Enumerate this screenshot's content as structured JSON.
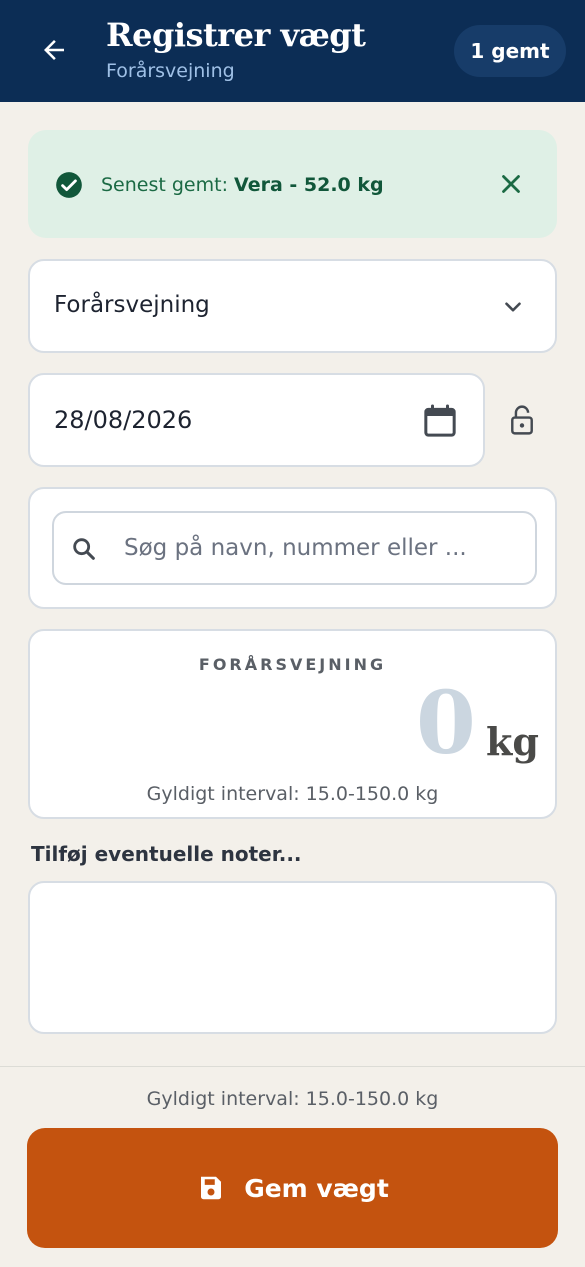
{
  "header": {
    "title": "Registrer vægt",
    "subtitle": "Forårsvejning",
    "saved_badge": "1 gemt",
    "back_icon": "arrow-left-icon"
  },
  "banner": {
    "prefix": "Senest gemt: ",
    "value": "Vera - 52.0 kg",
    "icon": "check-circle-icon",
    "close_icon": "close-icon",
    "color": "#1b6a44"
  },
  "form": {
    "weighing_select": {
      "value": "Forårsvejning",
      "icon": "chevron-down-icon"
    },
    "date": {
      "value": "28/08/2026",
      "icon": "calendar-icon"
    },
    "lock_icon": "lock-open-icon",
    "search": {
      "placeholder": "Søg på navn, nummer eller ...",
      "icon": "search-icon"
    }
  },
  "weight": {
    "label": "FORÅRSVEJNING",
    "value": "0",
    "unit": "kg",
    "valid_range": "Gyldigt interval: 15.0-150.0 kg"
  },
  "notes": {
    "label": "Tilføj eventuelle noter...",
    "value": ""
  },
  "footer": {
    "valid_range": "Gyldigt interval: 15.0-150.0 kg",
    "save_label": "Gem vægt",
    "save_icon": "save-icon",
    "button_color": "#c4530f"
  }
}
